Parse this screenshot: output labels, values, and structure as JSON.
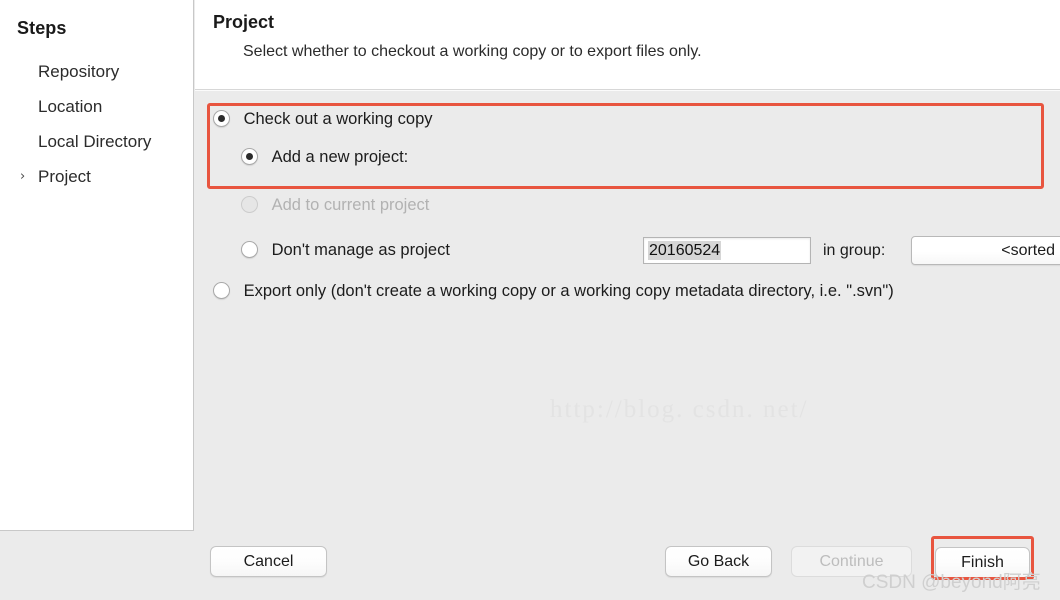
{
  "sidebar": {
    "title": "Steps",
    "items": [
      {
        "label": "Repository",
        "chevron": ""
      },
      {
        "label": "Location",
        "chevron": ""
      },
      {
        "label": "Local Directory",
        "chevron": ""
      },
      {
        "label": "Project",
        "chevron": "›"
      }
    ]
  },
  "content": {
    "title": "Project",
    "subtitle": "Select whether to checkout a working copy or to export files only."
  },
  "options": {
    "checkout": {
      "label": "Check out a working copy",
      "checked": true,
      "enabled": true
    },
    "new_project": {
      "label": "Add a new project:",
      "checked": true,
      "enabled": true,
      "field_value": "20160524",
      "field_placeholder": "",
      "in_group_label": "in group:",
      "group_value": "<sorted group>"
    },
    "add_to_current": {
      "label": "Add to current project",
      "checked": false,
      "enabled": false
    },
    "dont_manage": {
      "label": "Don't manage as project",
      "checked": false,
      "enabled": true
    },
    "export_only": {
      "label": "Export only (don't create a working copy or a working copy metadata directory, i.e. \".svn\")",
      "checked": false,
      "enabled": true
    }
  },
  "footer": {
    "cancel": "Cancel",
    "go_back": "Go Back",
    "continue": "Continue",
    "finish": "Finish"
  },
  "watermarks": {
    "url": "http://blog. csdn. net/",
    "csdn": "CSDN @beyond阿亮"
  },
  "colors": {
    "highlight_red": "#e8553f",
    "window_bg": "#ebebeb",
    "panel_white": "#ffffff"
  }
}
